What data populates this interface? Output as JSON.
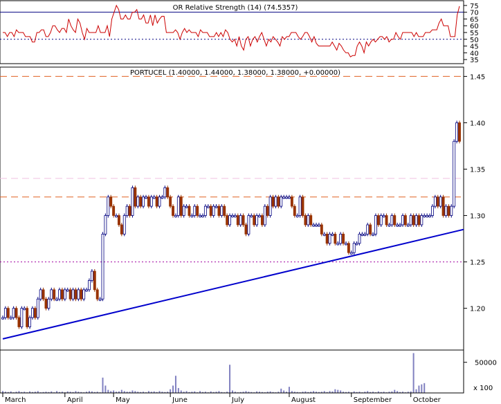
{
  "chart_data": [
    {
      "panel": "rsi",
      "type": "line",
      "title": "OR Relative Strength (14) (74.5357)",
      "y_ticks": [
        "35",
        "40",
        "45",
        "50",
        "55",
        "60",
        "65",
        "70",
        "75"
      ],
      "ylim": [
        33,
        77
      ],
      "levels": [
        70,
        50
      ],
      "line_color": "#cc0000",
      "values": [
        55,
        55,
        52,
        55,
        55,
        52,
        57,
        55,
        55,
        55,
        52,
        52,
        52,
        48,
        48,
        55,
        55,
        57,
        57,
        52,
        52,
        55,
        60,
        60,
        57,
        55,
        58,
        58,
        55,
        65,
        60,
        57,
        55,
        65,
        62,
        55,
        50,
        58,
        55,
        55,
        55,
        55,
        60,
        55,
        55,
        55,
        60,
        52,
        65,
        70,
        75,
        72,
        65,
        65,
        68,
        65,
        65,
        70,
        70,
        72,
        65,
        65,
        68,
        62,
        62,
        68,
        60,
        68,
        62,
        65,
        67,
        67,
        55,
        55,
        55,
        55,
        57,
        55,
        50,
        55,
        58,
        55,
        57,
        55,
        55,
        55,
        52,
        57,
        55,
        55,
        55,
        52,
        52,
        52,
        55,
        52,
        55,
        52,
        57,
        55,
        50,
        48,
        50,
        45,
        52,
        45,
        42,
        50,
        52,
        45,
        50,
        52,
        48,
        52,
        55,
        50,
        45,
        50,
        48,
        52,
        50,
        48,
        45,
        52,
        50,
        52,
        52,
        55,
        55,
        55,
        52,
        50,
        52,
        55,
        55,
        52,
        48,
        52,
        47,
        45,
        45,
        45,
        45,
        45,
        45,
        48,
        45,
        42,
        47,
        45,
        42,
        40,
        40,
        37,
        38,
        38,
        45,
        48,
        45,
        40,
        48,
        45,
        48,
        50,
        48,
        50,
        52,
        52,
        50,
        52,
        48,
        50,
        50,
        55,
        52,
        50,
        55,
        55,
        55,
        55,
        55,
        52,
        55,
        52,
        52,
        52,
        55,
        55,
        55,
        57,
        57,
        57,
        62,
        65,
        60,
        60,
        60,
        52,
        52,
        52,
        68,
        74.5
      ]
    },
    {
      "panel": "price",
      "type": "ohlc",
      "title": "PORTUCEL (1.40000, 1.44000, 1.38000, 1.38000, +0.00000)",
      "y_ticks": [
        "1.20",
        "1.25",
        "1.30",
        "1.35",
        "1.40",
        "1.45"
      ],
      "ylim": [
        1.155,
        1.46
      ],
      "up_color": "#000080",
      "down_color": "#993300",
      "levels": [
        {
          "value": 1.45,
          "color": "#e06020",
          "style": "long-dash"
        },
        {
          "value": 1.34,
          "color": "#f0c0e0",
          "style": "long-dash"
        },
        {
          "value": 1.32,
          "color": "#e06020",
          "style": "long-dash"
        },
        {
          "value": 1.25,
          "color": "#a000a0",
          "style": "dot"
        }
      ],
      "trendline": {
        "x": [
          0,
          195
        ],
        "y": [
          1.167,
          1.285
        ],
        "color": "#0000cc"
      },
      "x_labels": [
        {
          "label": "March",
          "index": 0
        },
        {
          "label": "April",
          "index": 23
        },
        {
          "label": "May",
          "index": 41
        },
        {
          "label": "June",
          "index": 62
        },
        {
          "label": "July",
          "index": 84
        },
        {
          "label": "August",
          "index": 106
        },
        {
          "label": "September",
          "index": 129
        },
        {
          "label": "October",
          "index": 151
        }
      ],
      "close": [
        1.19,
        1.2,
        1.19,
        1.19,
        1.2,
        1.19,
        1.18,
        1.2,
        1.2,
        1.18,
        1.19,
        1.2,
        1.19,
        1.21,
        1.22,
        1.21,
        1.2,
        1.21,
        1.22,
        1.21,
        1.21,
        1.22,
        1.21,
        1.22,
        1.22,
        1.21,
        1.22,
        1.21,
        1.22,
        1.21,
        1.22,
        1.22,
        1.23,
        1.24,
        1.22,
        1.21,
        1.21,
        1.28,
        1.3,
        1.32,
        1.31,
        1.3,
        1.3,
        1.29,
        1.28,
        1.3,
        1.31,
        1.3,
        1.33,
        1.31,
        1.32,
        1.31,
        1.32,
        1.32,
        1.31,
        1.32,
        1.32,
        1.31,
        1.32,
        1.32,
        1.33,
        1.32,
        1.31,
        1.3,
        1.3,
        1.32,
        1.3,
        1.31,
        1.31,
        1.3,
        1.3,
        1.31,
        1.3,
        1.3,
        1.3,
        1.31,
        1.31,
        1.3,
        1.31,
        1.31,
        1.3,
        1.31,
        1.3,
        1.29,
        1.3,
        1.3,
        1.3,
        1.29,
        1.3,
        1.29,
        1.28,
        1.3,
        1.3,
        1.29,
        1.3,
        1.3,
        1.29,
        1.31,
        1.3,
        1.32,
        1.31,
        1.32,
        1.31,
        1.32,
        1.32,
        1.32,
        1.32,
        1.31,
        1.3,
        1.3,
        1.32,
        1.3,
        1.29,
        1.3,
        1.29,
        1.29,
        1.29,
        1.29,
        1.28,
        1.28,
        1.27,
        1.28,
        1.28,
        1.27,
        1.27,
        1.28,
        1.27,
        1.27,
        1.26,
        1.26,
        1.27,
        1.27,
        1.28,
        1.28,
        1.28,
        1.29,
        1.28,
        1.28,
        1.3,
        1.29,
        1.3,
        1.3,
        1.29,
        1.29,
        1.3,
        1.29,
        1.29,
        1.29,
        1.3,
        1.29,
        1.29,
        1.3,
        1.29,
        1.3,
        1.29,
        1.3,
        1.3,
        1.3,
        1.3,
        1.31,
        1.32,
        1.31,
        1.32,
        1.3,
        1.31,
        1.3,
        1.31,
        1.38,
        1.4,
        1.38
      ],
      "volume_panel": {
        "y_ticks": [
          "50000"
        ],
        "y_tick_values": [
          50000
        ],
        "unit_label": "x 100",
        "ylim": [
          0,
          70000
        ],
        "color": "#8080c0",
        "values": [
          3000,
          2000,
          1500,
          2500,
          1000,
          2000,
          3000,
          1500,
          2000,
          1000,
          2500,
          1500,
          2000,
          3000,
          1000,
          1500,
          2000,
          1500,
          2500,
          1000,
          3000,
          1500,
          2000,
          1000,
          2500,
          2000,
          1500,
          3000,
          2000,
          1500,
          1000,
          2000,
          3000,
          2500,
          1500,
          2000,
          1000,
          25000,
          12000,
          5000,
          3000,
          4000,
          2000,
          2500,
          5000,
          3000,
          2000,
          2000,
          4000,
          3000,
          2000,
          1500,
          2000,
          1000,
          3000,
          2000,
          2500,
          1500,
          3000,
          2000,
          1500,
          2000,
          6000,
          12000,
          28000,
          8000,
          4000,
          2000,
          3000,
          1500,
          2000,
          2500,
          1000,
          3000,
          1500,
          2000,
          1000,
          2500,
          1500,
          2000,
          3000,
          1500,
          1000,
          2000,
          46000,
          4000,
          2000,
          1000,
          1500,
          2000,
          3000,
          2000,
          1500,
          1000,
          2500,
          2000,
          1500,
          1000,
          2000,
          2500,
          1500,
          1000,
          2000,
          7000,
          4000,
          2000,
          10000,
          3000,
          2000,
          1500,
          1000,
          2000,
          2500,
          1500,
          2000,
          3000,
          2000,
          1500,
          2000,
          3000,
          1500,
          3000,
          2500,
          6000,
          5000,
          4000,
          2000,
          1500,
          2000,
          1000,
          2500,
          1500,
          2000,
          1000,
          2000,
          3000,
          1500,
          2000,
          1000,
          2500,
          1500,
          2000,
          1000,
          2000,
          2500,
          5000,
          3000,
          1500,
          2000,
          1000,
          2000,
          2500,
          65000,
          6000,
          12000,
          14000,
          16000
        ]
      }
    }
  ]
}
